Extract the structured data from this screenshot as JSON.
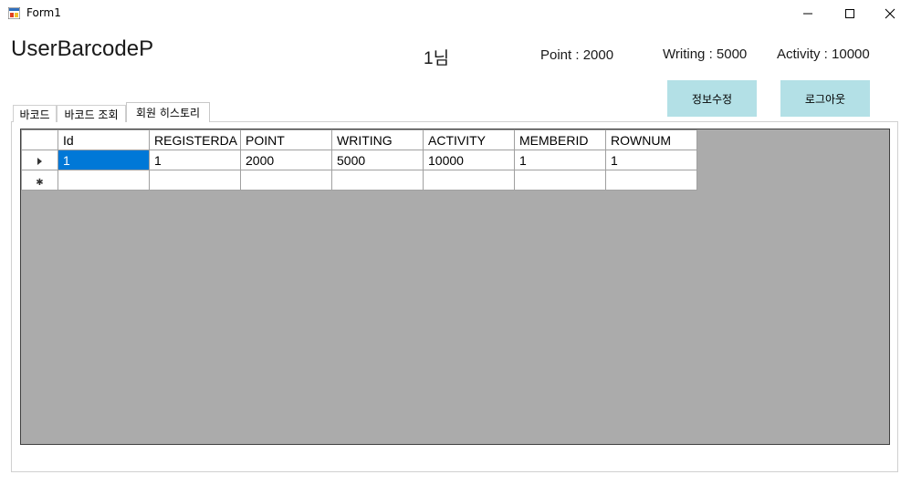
{
  "window": {
    "title": "Form1",
    "minimize_icon": "minimize-icon",
    "maximize_icon": "maximize-icon",
    "close_icon": "close-icon"
  },
  "header": {
    "user_title": "UserBarcodeP",
    "user_nim": "1님",
    "point": "Point : 2000",
    "writing": "Writing : 5000",
    "activity": "Activity : 10000"
  },
  "buttons": {
    "edit_info": "정보수정",
    "logout": "로그아웃"
  },
  "tabs": [
    {
      "label": "바코드"
    },
    {
      "label": "바코드 조회"
    },
    {
      "label": "회원 히스토리"
    }
  ],
  "grid": {
    "columns": [
      "Id",
      "REGISTERDA",
      "POINT",
      "WRITING",
      "ACTIVITY",
      "MEMBERID",
      "ROWNUM"
    ],
    "rows": [
      [
        "1",
        "1",
        "2000",
        "5000",
        "10000",
        "1",
        "1"
      ]
    ],
    "selected_cell": {
      "row": 0,
      "col": 0
    },
    "current_row_indicator": "row-arrow-icon",
    "new_row_indicator": "new-row-star-icon"
  },
  "colors": {
    "button_bg": "#b3e0e6",
    "grid_bg": "#ababab",
    "selection": "#0078d7"
  }
}
